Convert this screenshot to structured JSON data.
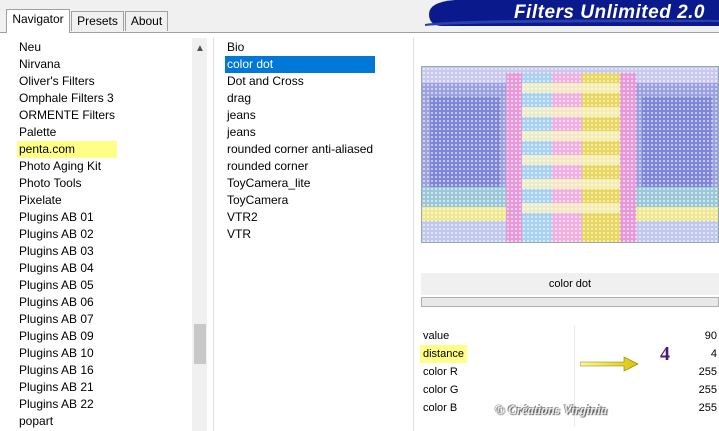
{
  "tabs": [
    {
      "label": "Navigator",
      "active": true
    },
    {
      "label": "Presets",
      "active": false
    },
    {
      "label": "About",
      "active": false
    }
  ],
  "banner": {
    "title": "Filters Unlimited 2.0",
    "color": "#0a1a8c"
  },
  "categories": [
    "Neu",
    "Nirvana",
    "Oliver's Filters",
    "Omphale Filters 3",
    "ORMENTE Filters",
    "Palette",
    "penta.com",
    "Photo Aging Kit",
    "Photo Tools",
    "Pixelate",
    "Plugins AB 01",
    "Plugins AB 02",
    "Plugins AB 03",
    "Plugins AB 04",
    "Plugins AB 05",
    "Plugins AB 06",
    "Plugins AB 07",
    "Plugins AB 09",
    "Plugins AB 10",
    "Plugins AB 16",
    "Plugins AB 21",
    "Plugins AB 22",
    "popart"
  ],
  "highlighted_category": "penta.com",
  "filters": [
    "Bio",
    "color dot",
    "Dot and Cross",
    "drag",
    "jeans",
    "jeans",
    "rounded corner anti-aliased",
    "rounded corner",
    "ToyCamera_lite",
    "ToyCamera",
    "VTR2",
    "VTR"
  ],
  "selected_filter": "color dot",
  "control_title": "color dot",
  "params": [
    {
      "name": "value",
      "value": "90",
      "highlight": false
    },
    {
      "name": "distance",
      "value": "4",
      "highlight": true
    },
    {
      "name": "color R",
      "value": "255",
      "highlight": false
    },
    {
      "name": "color G",
      "value": "255",
      "highlight": false
    },
    {
      "name": "color B",
      "value": "255",
      "highlight": false
    }
  ],
  "annotation": {
    "number": "4"
  },
  "watermark": "© Créations Virginia",
  "colors": {
    "selection": "#0078d7",
    "highlight": "#ffff88",
    "arrow": "#e6d800"
  }
}
